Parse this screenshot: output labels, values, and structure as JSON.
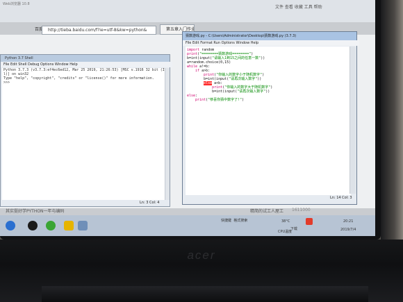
{
  "browser": {
    "title": "Web浏览器 10.8",
    "address_prefix": "百度",
    "address": "http://tieba.baidu.com/f?ie=utf-8&kw=python&",
    "tab": "第五章入门作业了",
    "menu": "文件  查看  收藏  工具  帮助",
    "list_item_1": "其实挺好学PYTHON一年与编码",
    "list_item_2": "精简的试工人屋工",
    "list_item_3": "1611000"
  },
  "shell": {
    "title": "Python 3.7 Shell",
    "menu": "File  Edit  Shell  Debug  Options  Window  Help",
    "lines": [
      "Python 3.7.3 (v3.7.3:ef4ec6ed12, Mar 25 2019, 21:26:53) [MSC v.1916 32 bit (Inte",
      "l)] on win32",
      "Type \"help\", \"copyright\", \"credits\" or \"license()\" for more information.",
      ">>> "
    ],
    "status": "Ln: 3  Col: 4"
  },
  "editor": {
    "title": "猜数游戏.py - C:\\Users\\Administrator\\Desktop\\猜数游戏.py (3.7.3)",
    "menu": "File  Edit  Format  Run  Options  Window  Help",
    "status": "Ln: 14  Col: 3"
  },
  "taskbar": {
    "light_label": "快捷键",
    "light_label_2": "格式搜索",
    "status": "下载",
    "temp": "38°C",
    "cpu": "CPU温度",
    "time": "20:21",
    "date": "2019/7/4"
  },
  "hardware": {
    "brand": "acer"
  }
}
